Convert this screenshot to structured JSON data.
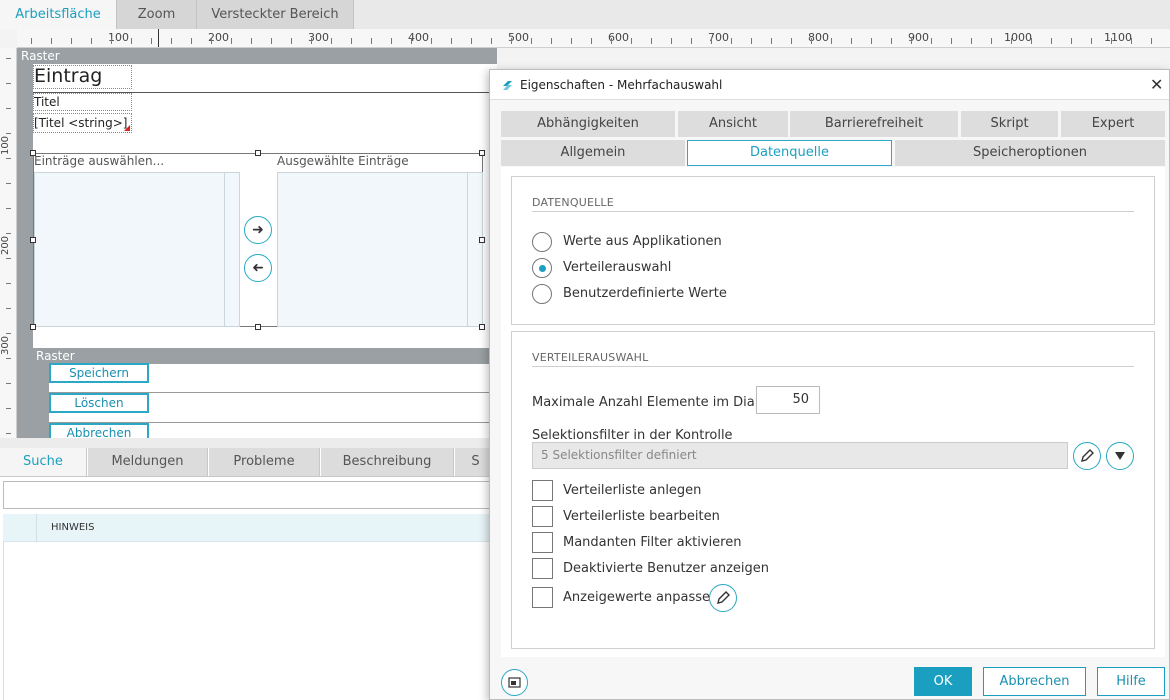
{
  "top_tabs": [
    {
      "label": "Arbeitsfläche"
    },
    {
      "label": "Zoom"
    },
    {
      "label": "Versteckter Bereich"
    }
  ],
  "ruler": {
    "h_labels": [
      "100",
      "200",
      "300",
      "400",
      "500",
      "600",
      "700",
      "800",
      "900",
      "1000",
      "1100"
    ],
    "v_labels": [
      "100",
      "200",
      "300"
    ]
  },
  "canvas": {
    "raster_label": "Raster",
    "eintrag_title": "Eintrag",
    "titel_label": "Titel",
    "titel_field": "[Titel <string>]",
    "left_list_label": "Einträge auswählen...",
    "right_list_label": "Ausgewählte Einträge",
    "arrow_right": "➜",
    "arrow_left": "➜",
    "raster2_label": "Raster",
    "buttons": [
      "Speichern",
      "Löschen",
      "Abbrechen"
    ]
  },
  "bottom_tabs": [
    {
      "label": "Suche"
    },
    {
      "label": "Meldungen"
    },
    {
      "label": "Probleme"
    },
    {
      "label": "Beschreibung"
    },
    {
      "label": "S"
    }
  ],
  "bottom_table": {
    "column_header": "HINWEIS"
  },
  "dialog": {
    "title": "Eigenschaften - Mehrfachauswahl",
    "close": "✕",
    "tabs_row1": [
      "Abhängigkeiten",
      "Ansicht",
      "Barrierefreiheit",
      "Skript",
      "Expert"
    ],
    "tabs_row2": [
      "Allgemein",
      "Datenquelle",
      "Speicheroptionen"
    ],
    "section1": {
      "heading": "DATENQUELLE",
      "options": [
        "Werte aus Applikationen",
        "Verteilerauswahl",
        "Benutzerdefinierte Werte"
      ],
      "selected_index": 1
    },
    "section2": {
      "heading": "VERTEILERAUSWAHL",
      "max_label": "Maximale Anzahl Elemente im Dialog",
      "max_value": "50",
      "filter_label": "Selektionsfilter in der Kontrolle",
      "filter_value": "5 Selektionsfilter definiert",
      "checkboxes": [
        "Verteilerliste anlegen",
        "Verteilerliste bearbeiten",
        "Mandanten Filter aktivieren",
        "Deaktivierte Benutzer anzeigen",
        "Anzeigewerte anpassen"
      ]
    },
    "footer": {
      "ok": "OK",
      "cancel": "Abbrechen",
      "help": "Hilfe"
    }
  },
  "colors": {
    "accent": "#1a9fc0",
    "raster_gray": "#9aa0a3"
  }
}
